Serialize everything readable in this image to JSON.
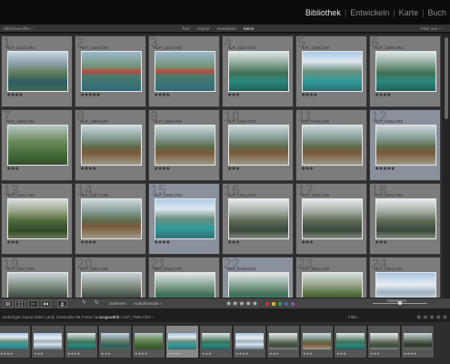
{
  "modules": {
    "items": [
      "Bibliothek",
      "Entwickeln",
      "Karte",
      "Buch"
    ],
    "active": "Bibliothek"
  },
  "filter_bar": {
    "title": "Bibliotheksfilter :",
    "tabs": [
      "Text",
      "Attribut",
      "Metadaten",
      "Keine"
    ],
    "active_tab": "Keine",
    "preset": "Filter aus ÷"
  },
  "grid": {
    "cells": [
      {
        "index": "1",
        "file": "ALP_1312.CR2",
        "stars": "★★★★",
        "selected": false,
        "img": "a"
      },
      {
        "index": "2",
        "file": "ALP_1316.CR2",
        "stars": "★★★★★",
        "selected": false,
        "img": "b"
      },
      {
        "index": "3",
        "file": "ALP_1320.CR2",
        "stars": "★★★★",
        "selected": false,
        "img": "b"
      },
      {
        "index": "4",
        "file": "ALP_1327.CR2",
        "stars": "★★★",
        "selected": false,
        "img": "c"
      },
      {
        "index": "5",
        "file": "ALP_1348.CR2",
        "stars": "★★★★",
        "selected": false,
        "img": "d"
      },
      {
        "index": "6",
        "file": "ALP_1359.CR2",
        "stars": "★★★★",
        "selected": false,
        "img": "c"
      },
      {
        "index": "7",
        "file": "ALP_1380.CR2",
        "stars": "★★★",
        "selected": false,
        "img": "e"
      },
      {
        "index": "8",
        "file": "ALP_1389.CR2",
        "stars": "★★★★",
        "selected": false,
        "img": "f"
      },
      {
        "index": "9",
        "file": "ALP_1392.CR2",
        "stars": "★★★★",
        "selected": false,
        "img": "f"
      },
      {
        "index": "10",
        "file": "ALP_1402.CR2",
        "stars": "★★★",
        "selected": false,
        "img": "f"
      },
      {
        "index": "11",
        "file": "ALP_1403.CR2",
        "stars": "★★★",
        "selected": false,
        "img": "f"
      },
      {
        "index": "12",
        "file": "ALP_1406.CR2",
        "stars": "★★★★★",
        "selected": true,
        "img": "f"
      },
      {
        "index": "13",
        "file": "ALP_1421.CR2",
        "stars": "★★★",
        "selected": false,
        "img": "g"
      },
      {
        "index": "14",
        "file": "ALP_1427.CR2",
        "stars": "★★★★",
        "selected": false,
        "img": "f"
      },
      {
        "index": "15",
        "file": "ALP_1430.CR2",
        "stars": "★★★★",
        "selected": true,
        "img": "d"
      },
      {
        "index": "16",
        "file": "ALP_1434.CR2",
        "stars": "★★★",
        "selected": false,
        "img": "h"
      },
      {
        "index": "17",
        "file": "ALP_1530.CR2",
        "stars": "★★★",
        "selected": false,
        "img": "h"
      },
      {
        "index": "18",
        "file": "ALP_1536.CR2",
        "stars": "★★★",
        "selected": false,
        "img": "h"
      },
      {
        "index": "19",
        "file": "ALP_1557.CR2",
        "stars": "",
        "selected": false,
        "img": "i"
      },
      {
        "index": "20",
        "file": "ALP_1561.CR2",
        "stars": "",
        "selected": false,
        "img": "i"
      },
      {
        "index": "21",
        "file": "IMG_3436.CR2",
        "stars": "",
        "selected": false,
        "img": "c"
      },
      {
        "index": "22",
        "file": "IMG_3448.CR2",
        "stars": "",
        "selected": true,
        "img": "c"
      },
      {
        "index": "23",
        "file": "ALP_1601.CR2",
        "stars": "",
        "selected": false,
        "img": "g"
      },
      {
        "index": "24",
        "file": "ALP_1651.CR2",
        "stars": "",
        "selected": false,
        "img": "j"
      }
    ]
  },
  "toolbar": {
    "sort_label": "Sortieren:",
    "sort_value": "Aufnahmezeit ÷",
    "rating": "★★★★★",
    "thumb_label": "Miniaturen"
  },
  "color_labels": {
    "colors": [
      "#c23b3b",
      "#d9b22e",
      "#3c9a3c",
      "#3f6bc7",
      "#8d4fb5"
    ]
  },
  "status": {
    "path_prefix": "Vorheriger Import",
    "path_collection": "ieder Land: Gesteckte",
    "count": "86 Fotos /",
    "selected": "1 ausgewählt",
    "current_file": "/ ALP_7065.CR2 ÷",
    "filter_label": "Filter:"
  },
  "filmstrip": {
    "frames": [
      {
        "img": "d",
        "star": "★★★★",
        "selected": false
      },
      {
        "img": "j",
        "star": "★★★",
        "selected": false
      },
      {
        "img": "c",
        "star": "★★★★",
        "selected": false
      },
      {
        "img": "a",
        "star": "★★★",
        "selected": false
      },
      {
        "img": "e",
        "star": "★★★★",
        "selected": false
      },
      {
        "img": "d",
        "star": "★★★★",
        "selected": true
      },
      {
        "img": "c",
        "star": "★★★",
        "selected": false
      },
      {
        "img": "j",
        "star": "★★★★",
        "selected": false
      },
      {
        "img": "h",
        "star": "★★★",
        "selected": false
      },
      {
        "img": "f",
        "star": "★★★",
        "selected": false
      },
      {
        "img": "c",
        "star": "★★★",
        "selected": false
      },
      {
        "img": "h",
        "star": "★★★",
        "selected": false
      },
      {
        "img": "i",
        "star": "★★★★",
        "selected": false
      }
    ]
  },
  "image_gradients": {
    "a": "linear-gradient(180deg,#c6d6e2 0%,#8aa0a6 30%,#5d7a5b 55%,#2f5d63 75%,#3e6a58 100%)",
    "b": "linear-gradient(180deg,#9ab8cc 0%,#6f8f72 40%,#b94a3f 50%,#4b7a6e 62%,#2f6b78 100%)",
    "c": "linear-gradient(180deg,#dfe7ea 0%,#7d9c8a 35%,#3f6f55 55%,#2b8a7d 75%,#1f5f5a 100%)",
    "d": "linear-gradient(180deg,#a9c9e8 0%,#dfe8f0 25%,#6c8e7e 50%,#2f9a9a 75%,#2e6f74 100%)",
    "e": "linear-gradient(180deg,#b7c8c8 0%,#6c8a5c 40%,#4c7340 65%,#304f2a 100%)",
    "f": "linear-gradient(180deg,#cfd8dc 0%,#89a19a 30%,#5c6a4a 55%,#7a5a3a 70%,#9e9a86 100%)",
    "g": "linear-gradient(180deg,#d8dee0 0%,#9aa68a 30%,#4f6b3a 55%,#2f4a26 80%,#6c7856 100%)",
    "h": "linear-gradient(180deg,#e6e9ea 0%,#a7b0a8 30%,#5d6b56 55%,#39463a 80%,#828d80 100%)",
    "i": "linear-gradient(180deg,#c8d2d8 0%,#8a968c 30%,#4d5a4e 55%,#2b3328 75%,#6b6f62 100%)",
    "j": "linear-gradient(180deg,#a8c3e0 0%,#e8eef2 30%,#9fb0bc 50%,#d8e2ea 70%,#607a8a 100%)"
  },
  "theme": {
    "accent_selected": "#8a909c",
    "badge": "#2a3f6a"
  }
}
